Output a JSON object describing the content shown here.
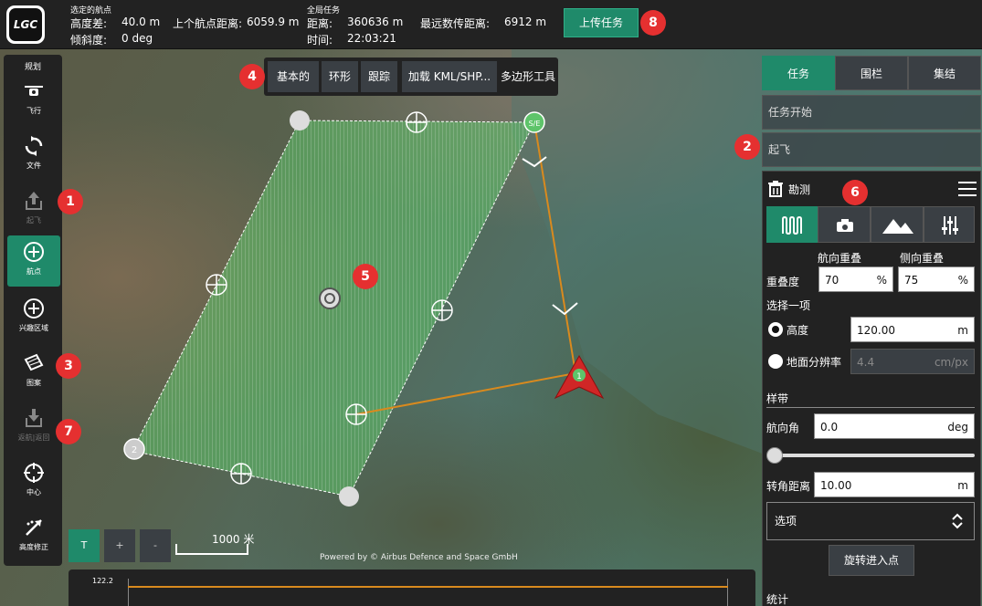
{
  "app": {
    "logo_text": "LGC"
  },
  "topbar": {
    "selected_wp_title": "选定的航点",
    "alt_diff_label": "高度差:",
    "alt_diff_value": "40.0 m",
    "prev_wp_dist_label": "上个航点距离:",
    "prev_wp_dist_value": "6059.9 m",
    "gradient_label": "倾斜度:",
    "gradient_value": "0 deg",
    "global_title": "全局任务",
    "distance_label": "距离:",
    "distance_value": "360636 m",
    "time_label": "时间:",
    "time_value": "22:03:21",
    "max_telem_label": "最远数传距离:",
    "max_telem_value": "6912 m",
    "upload_label": "上传任务"
  },
  "left_toolbar": {
    "header": "规划",
    "items": [
      {
        "label": "飞行",
        "icon": "drone-icon"
      },
      {
        "label": "文件",
        "icon": "sync-icon"
      },
      {
        "label": "起飞",
        "icon": "takeoff-icon"
      },
      {
        "label": "航点",
        "icon": "plus-circle-icon"
      },
      {
        "label": "兴趣区域",
        "icon": "plus-circle-icon"
      },
      {
        "label": "图案",
        "icon": "pattern-icon"
      },
      {
        "label": "返航|返回",
        "icon": "return-icon"
      },
      {
        "label": "中心",
        "icon": "crosshair-icon"
      },
      {
        "label": "高度修正",
        "icon": "altitude-icon"
      }
    ]
  },
  "map_tools": {
    "basic": "基本的",
    "circle": "环形",
    "trace": "跟踪",
    "load": "加载 KML/SHP...",
    "title": "多边形工具"
  },
  "map": {
    "wp_start": "S/E",
    "wp_1": "1",
    "wp_2": "2",
    "scale_label": "1000 米",
    "zoom_t": "T",
    "zoom_in": "+",
    "zoom_out": "-",
    "powered_by": "Powered by © Airbus Defence and Space GmbH"
  },
  "badges": [
    "1",
    "2",
    "3",
    "4",
    "5",
    "6",
    "7",
    "8"
  ],
  "right_panel": {
    "tabs": [
      "任务",
      "围栏",
      "集结"
    ],
    "mission_start": "任务开始",
    "takeoff": "起飞",
    "survey_title": "勘测",
    "overlap_front_label": "航向重叠",
    "overlap_side_label": "侧向重叠",
    "overlap_label": "重叠度",
    "overlap_front_value": "70",
    "overlap_side_value": "75",
    "percent": "%",
    "select_one": "选择一项",
    "altitude_label": "高度",
    "altitude_value": "120.00",
    "altitude_unit": "m",
    "gsd_label": "地面分辨率",
    "gsd_value": "4.4",
    "gsd_unit": "cm/px",
    "transects": "样带",
    "heading_label": "航向角",
    "heading_value": "0.0",
    "heading_unit": "deg",
    "turn_label": "转角距离",
    "turn_value": "10.00",
    "turn_unit": "m",
    "options_label": "选项",
    "rotate_entry": "旋转进入点",
    "stats": "统计"
  },
  "profile": {
    "tick_top": "122.2"
  },
  "colors": {
    "accent": "#1f8a6a",
    "survey_green": "#5ec46a",
    "path_orange": "#d98a1e",
    "badge_red": "#e53030"
  }
}
